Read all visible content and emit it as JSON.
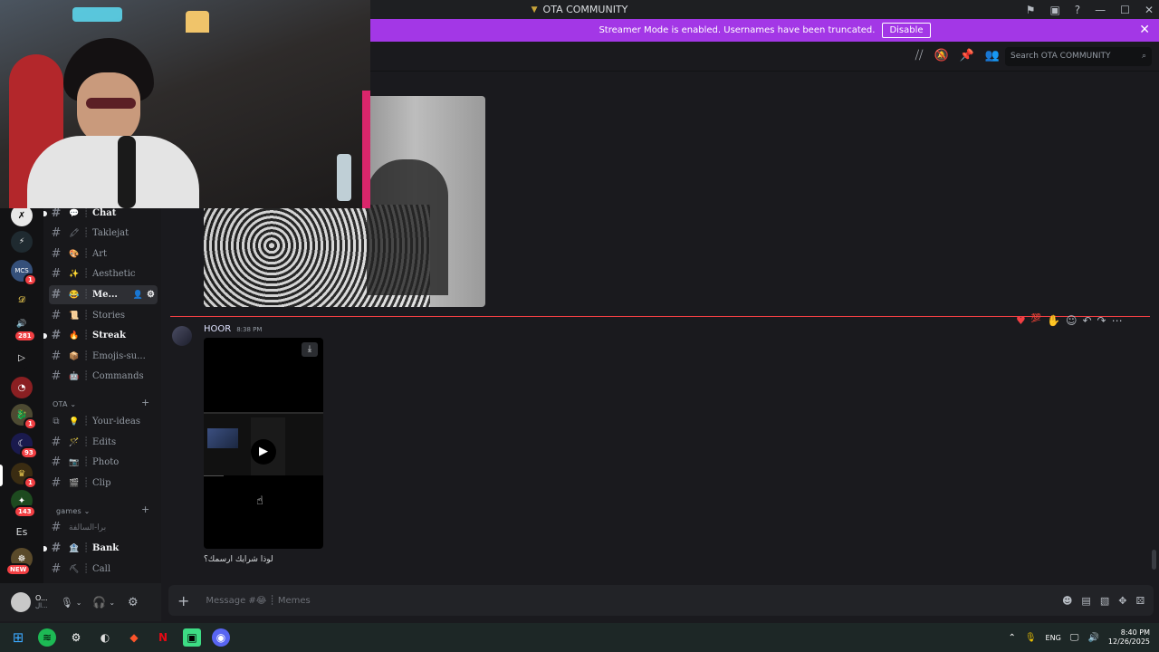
{
  "titlebar": {
    "title": "OTA COMMUNITY"
  },
  "banner": {
    "text": "Streamer Mode is enabled. Usernames have been truncated.",
    "button": "Disable"
  },
  "header": {
    "search_placeholder": "Search OTA COMMUNITY"
  },
  "rail": {
    "badges": [
      "1",
      "281",
      "1",
      "93",
      "1",
      "143"
    ],
    "es_label": "Es",
    "new_label": "NEW"
  },
  "channels": {
    "items": [
      {
        "emoji": "💬",
        "label": "Chat"
      },
      {
        "emoji": "🖍",
        "label": "Taklejat"
      },
      {
        "emoji": "🎨",
        "label": "Art"
      },
      {
        "emoji": "✨",
        "label": "Aesthetic"
      },
      {
        "emoji": "😂",
        "label": "Me..."
      },
      {
        "emoji": "📜",
        "label": "Stories"
      },
      {
        "emoji": "🔥",
        "label": "Streak"
      },
      {
        "emoji": "📦",
        "label": "Emojis-su..."
      },
      {
        "emoji": "🤖",
        "label": "Commands"
      }
    ],
    "category_ota": "OTA",
    "ota_items": [
      {
        "emoji": "💡",
        "label": "Your-ideas"
      },
      {
        "emoji": "🪄",
        "label": "Edits"
      },
      {
        "emoji": "📷",
        "label": "Photo"
      },
      {
        "emoji": "🎬",
        "label": "Clip"
      }
    ],
    "category_games": "games",
    "games_items": [
      {
        "emoji": "",
        "label": "برا-السالفة"
      },
      {
        "emoji": "🏦",
        "label": "Bank"
      },
      {
        "emoji": "⛏",
        "label": "Call"
      }
    ]
  },
  "user": {
    "name": "O...",
    "status": "ال..."
  },
  "message": {
    "author": "HOOR",
    "time": "8:38 PM",
    "text": "لوذا شرايك ارسمك؟"
  },
  "composer": {
    "placeholder": "Message #😂 ┊ Memes"
  },
  "taskbar": {
    "lang": "ENG",
    "time": "8:40 PM",
    "date": "12/26/2025"
  },
  "colors": {
    "banner": "#a337e6",
    "accent": "#f23f43",
    "divider": "#f23f43"
  }
}
